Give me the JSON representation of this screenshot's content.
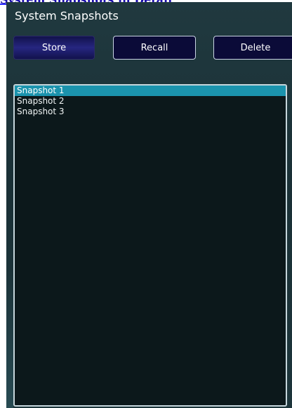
{
  "page": {
    "link_text": "System Snapshots in Detail"
  },
  "panel": {
    "title": "System Snapshots"
  },
  "buttons": {
    "store_label": "Store",
    "recall_label": "Recall",
    "delete_label": "Delete"
  },
  "snapshots": [
    {
      "label": "Snapshot 1",
      "selected": true
    },
    {
      "label": "Snapshot 2",
      "selected": false
    },
    {
      "label": "Snapshot 3",
      "selected": false
    }
  ],
  "colors": {
    "panel_bg": "#1d353b",
    "list_bg": "#0c181b",
    "selection": "#1b93ad",
    "button_bg": "#0b0b38",
    "link": "#1a0dab"
  }
}
